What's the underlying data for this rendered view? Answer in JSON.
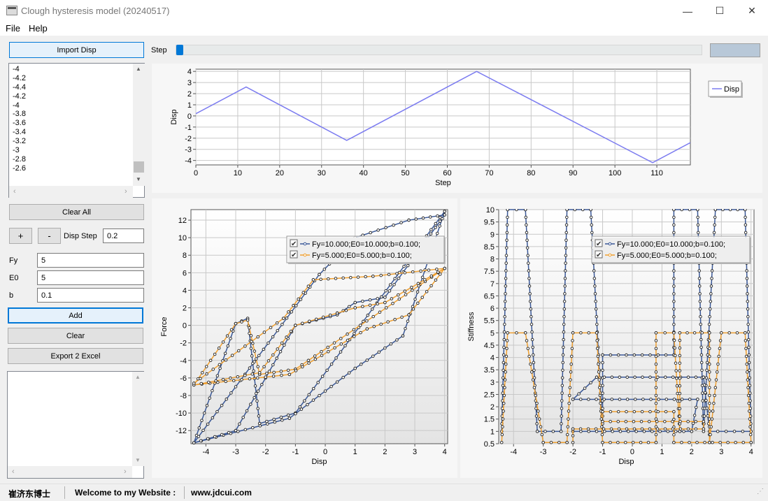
{
  "window": {
    "title": "Clough hysteresis model (20240517)",
    "minimize": "—",
    "maximize": "☐",
    "close": "✕"
  },
  "menu": [
    "File",
    "Help"
  ],
  "left": {
    "import_button": "Import Disp",
    "disp_list": [
      "-4",
      "-4.2",
      "-4.4",
      "-4.2",
      "-4",
      "-3.8",
      "-3.6",
      "-3.4",
      "-3.2",
      "-3",
      "-2.8",
      "-2.6"
    ],
    "clear_all_button": "Clear All",
    "plus_button": "+",
    "minus_button": "-",
    "disp_step_label": "Disp Step",
    "disp_step_value": "0.2",
    "fy_label": "Fy",
    "fy_value": "5",
    "e0_label": "E0",
    "e0_value": "5",
    "b_label": "b",
    "b_value": "0.1",
    "add_button": "Add",
    "clear_button": "Clear",
    "export_button": "Export 2 Excel"
  },
  "step_slider": {
    "label": "Step",
    "value": 0
  },
  "status_bar": {
    "author": "崔济东博士",
    "welcome": "Welcome to my Website :",
    "url": "www.jdcui.com"
  },
  "chart_data": [
    {
      "type": "line",
      "xlabel": "Step",
      "ylabel": "Disp",
      "xlim": [
        0,
        118
      ],
      "ylim": [
        -4.4,
        4.2
      ],
      "xticks": [
        0,
        10,
        20,
        30,
        40,
        50,
        60,
        70,
        80,
        90,
        100,
        110
      ],
      "yticks": [
        4,
        3,
        2,
        1,
        0,
        -1,
        -2,
        -3,
        -4
      ],
      "series": [
        {
          "name": "Disp",
          "color": "#7b7bf0",
          "points": [
            [
              0,
              0.2
            ],
            [
              12,
              2.6
            ],
            [
              36,
              -2.2
            ],
            [
              67,
              4.0
            ],
            [
              109,
              -4.2
            ],
            [
              118,
              -2.4
            ]
          ]
        }
      ],
      "legend": "right"
    },
    {
      "type": "line",
      "xlabel": "Disp",
      "ylabel": "Force",
      "xlim": [
        -4.5,
        4.1
      ],
      "ylim": [
        -13.5,
        13.2
      ],
      "xticks": [
        -4,
        -3,
        -2,
        -1,
        0,
        1,
        2,
        3,
        4
      ],
      "yticks": [
        12,
        10,
        8,
        6,
        4,
        2,
        0,
        -2,
        -4,
        -6,
        -8,
        -10,
        -12
      ],
      "legend": "top-right",
      "series": [
        {
          "name": "Fy=10.000;E0=10.000;b=0.100;",
          "color": "#3b5998",
          "points": [
            [
              -4.4,
              -13.4
            ],
            [
              -3.0,
              0.2
            ],
            [
              -2.6,
              0.8
            ],
            [
              -2.2,
              -11.2
            ],
            [
              -1.0,
              -10.0
            ],
            [
              4.0,
              13.0
            ],
            [
              2.6,
              -1.2
            ],
            [
              1.0,
              -4.9
            ],
            [
              -1.2,
              -10.6
            ],
            [
              -4.4,
              -13.4
            ],
            [
              -3.0,
              -12.0
            ],
            [
              -1.0,
              0.0
            ],
            [
              0.4,
              1.2
            ],
            [
              1.0,
              2.6
            ],
            [
              2.0,
              3.2
            ],
            [
              4.0,
              12.6
            ],
            [
              2.8,
              12.0
            ],
            [
              1.0,
              10.0
            ],
            [
              -0.2,
              5.8
            ],
            [
              -4.4,
              -13.4
            ]
          ]
        },
        {
          "name": "Fy=5.000;E0=5.000;b=0.100;",
          "color": "#f0a030",
          "points": [
            [
              -4.4,
              -6.8
            ],
            [
              -3.0,
              0.2
            ],
            [
              -2.6,
              0.6
            ],
            [
              -2.2,
              -5.6
            ],
            [
              -1.0,
              -5.0
            ],
            [
              4.0,
              6.5
            ],
            [
              2.8,
              1.2
            ],
            [
              1.4,
              -0.4
            ],
            [
              -1.2,
              -5.6
            ],
            [
              -4.4,
              -6.8
            ],
            [
              -2.2,
              -5.4
            ],
            [
              -1.0,
              0.0
            ],
            [
              0.4,
              1.4
            ],
            [
              1.0,
              2.0
            ],
            [
              2.0,
              2.6
            ],
            [
              4.0,
              6.5
            ],
            [
              1.6,
              5.6
            ],
            [
              -0.4,
              5.2
            ],
            [
              -1.4,
              0.8
            ],
            [
              -4.4,
              -6.6
            ]
          ]
        }
      ]
    },
    {
      "type": "line",
      "xlabel": "Disp",
      "ylabel": "Stiffness",
      "xlim": [
        -4.5,
        4.1
      ],
      "ylim": [
        0.5,
        10
      ],
      "xticks": [
        -4,
        -3,
        -2,
        -1,
        0,
        1,
        2,
        3,
        4
      ],
      "yticks": [
        10,
        9.5,
        9,
        8.5,
        8,
        7.5,
        7,
        6.5,
        6,
        5.5,
        5,
        4.5,
        4,
        3.5,
        3,
        2.5,
        2,
        1.5,
        1,
        0.5
      ],
      "legend": "top-right",
      "series": [
        {
          "name": "Fy=10.000;E0=10.000;b=0.100;",
          "color": "#3b5998",
          "points": [
            [
              -4.4,
              1
            ],
            [
              -4.2,
              10
            ],
            [
              -3.6,
              10
            ],
            [
              -3.2,
              1
            ],
            [
              -2.4,
              1
            ],
            [
              -2.2,
              10
            ],
            [
              -1.4,
              10
            ],
            [
              -1.0,
              1
            ],
            [
              -1.0,
              4.1
            ],
            [
              1.4,
              4.1
            ],
            [
              1.4,
              10
            ],
            [
              2.2,
              10
            ],
            [
              2.4,
              1
            ],
            [
              2.8,
              10
            ],
            [
              3.8,
              10
            ],
            [
              4.0,
              1
            ],
            [
              2.6,
              1
            ],
            [
              2.4,
              3.2
            ],
            [
              -1.2,
              3.2
            ],
            [
              -2.0,
              2.3
            ],
            [
              2.2,
              2.3
            ],
            [
              2.0,
              1.0
            ],
            [
              -2.0,
              1.0
            ]
          ]
        },
        {
          "name": "Fy=5.000;E0=5.000;b=0.100;",
          "color": "#f0a030",
          "points": [
            [
              -4.4,
              0.55
            ],
            [
              -4.2,
              5
            ],
            [
              -3.6,
              5
            ],
            [
              -3.0,
              0.55
            ],
            [
              -2.2,
              0.55
            ],
            [
              -2.0,
              5
            ],
            [
              -1.2,
              5
            ],
            [
              -1.0,
              0.55
            ],
            [
              0.8,
              0.55
            ],
            [
              0.8,
              5
            ],
            [
              1.4,
              5
            ],
            [
              1.6,
              1.0
            ],
            [
              1.6,
              5.0
            ],
            [
              2.6,
              5
            ],
            [
              2.6,
              0.55
            ],
            [
              3.0,
              5
            ],
            [
              3.8,
              5
            ],
            [
              4.0,
              0.55
            ],
            [
              1.4,
              0.55
            ],
            [
              1.4,
              1.8
            ],
            [
              -1.0,
              1.8
            ],
            [
              -1.0,
              1.4
            ],
            [
              2.4,
              1.4
            ],
            [
              2.4,
              1.1
            ],
            [
              -2.0,
              1.1
            ],
            [
              -2.0,
              0.55
            ]
          ]
        }
      ]
    }
  ]
}
